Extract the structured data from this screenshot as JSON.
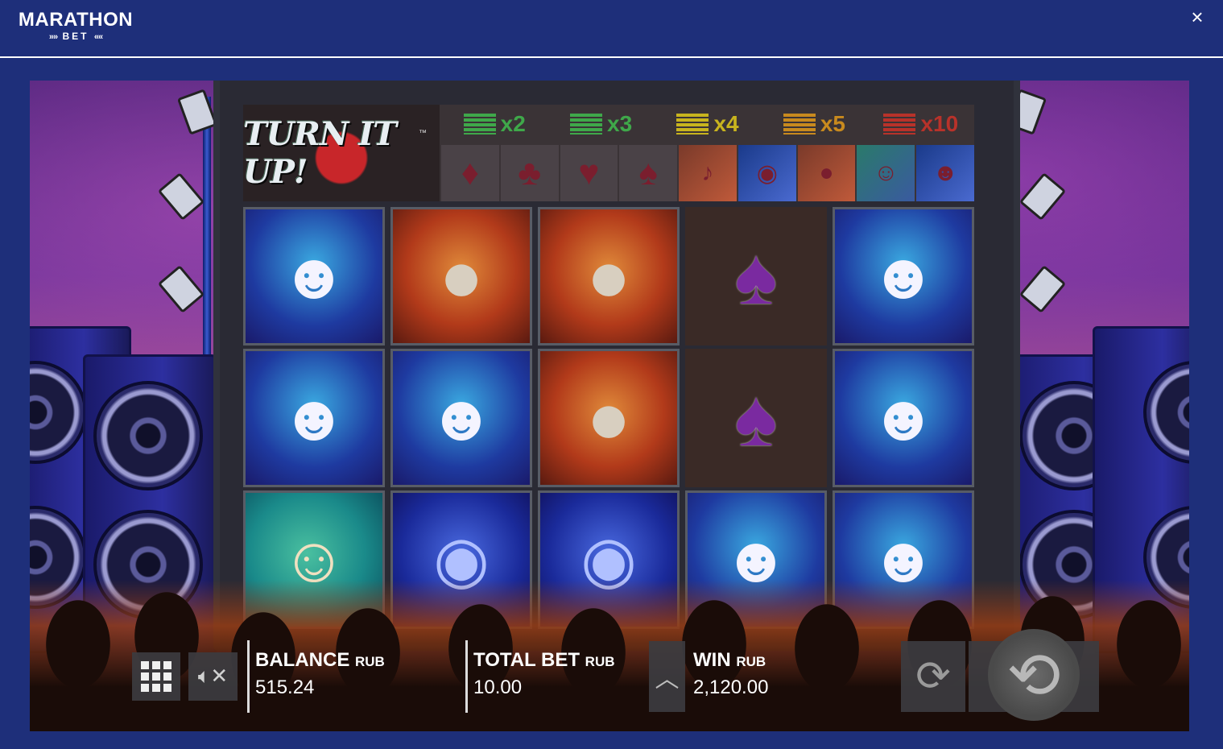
{
  "brand": {
    "name_line1": "MARATHON",
    "name_line2": "BET",
    "wing_left": "»»",
    "wing_right": "««"
  },
  "window": {
    "close_glyph": "×"
  },
  "game": {
    "title": "TURN IT UP!",
    "trademark": "™",
    "multipliers": [
      {
        "label": "x2",
        "color": "#3fa84a"
      },
      {
        "label": "x3",
        "color": "#3fa84a"
      },
      {
        "label": "x4",
        "color": "#c8b41e"
      },
      {
        "label": "x5",
        "color": "#c88a1e"
      },
      {
        "label": "x10",
        "color": "#b8322a"
      }
    ],
    "paytable_symbols": [
      "♦",
      "♣",
      "♥",
      "♠",
      "guitar",
      "drums",
      "microphone",
      "bassist",
      "drummer"
    ],
    "reels": [
      [
        "drummer",
        "drummer",
        "bassist"
      ],
      [
        "microphone",
        "drummer",
        "drum-kit"
      ],
      [
        "microphone",
        "microphone",
        "drum-kit"
      ],
      [
        "spade",
        "spade",
        "drummer"
      ],
      [
        "drummer",
        "drummer",
        "drummer"
      ]
    ]
  },
  "controls": {
    "balance": {
      "label": "BALANCE",
      "currency": "RUB",
      "value": "515.24"
    },
    "total_bet": {
      "label": "TOTAL BET",
      "currency": "RUB",
      "value": "10.00"
    },
    "win": {
      "label": "WIN",
      "currency": "RUB",
      "value": "2,120.00"
    },
    "sound_state": "muted",
    "colors": {
      "bar_bg": "#3c3c40",
      "text": "#ffffff",
      "page_bg": "#1e2f7a"
    }
  }
}
